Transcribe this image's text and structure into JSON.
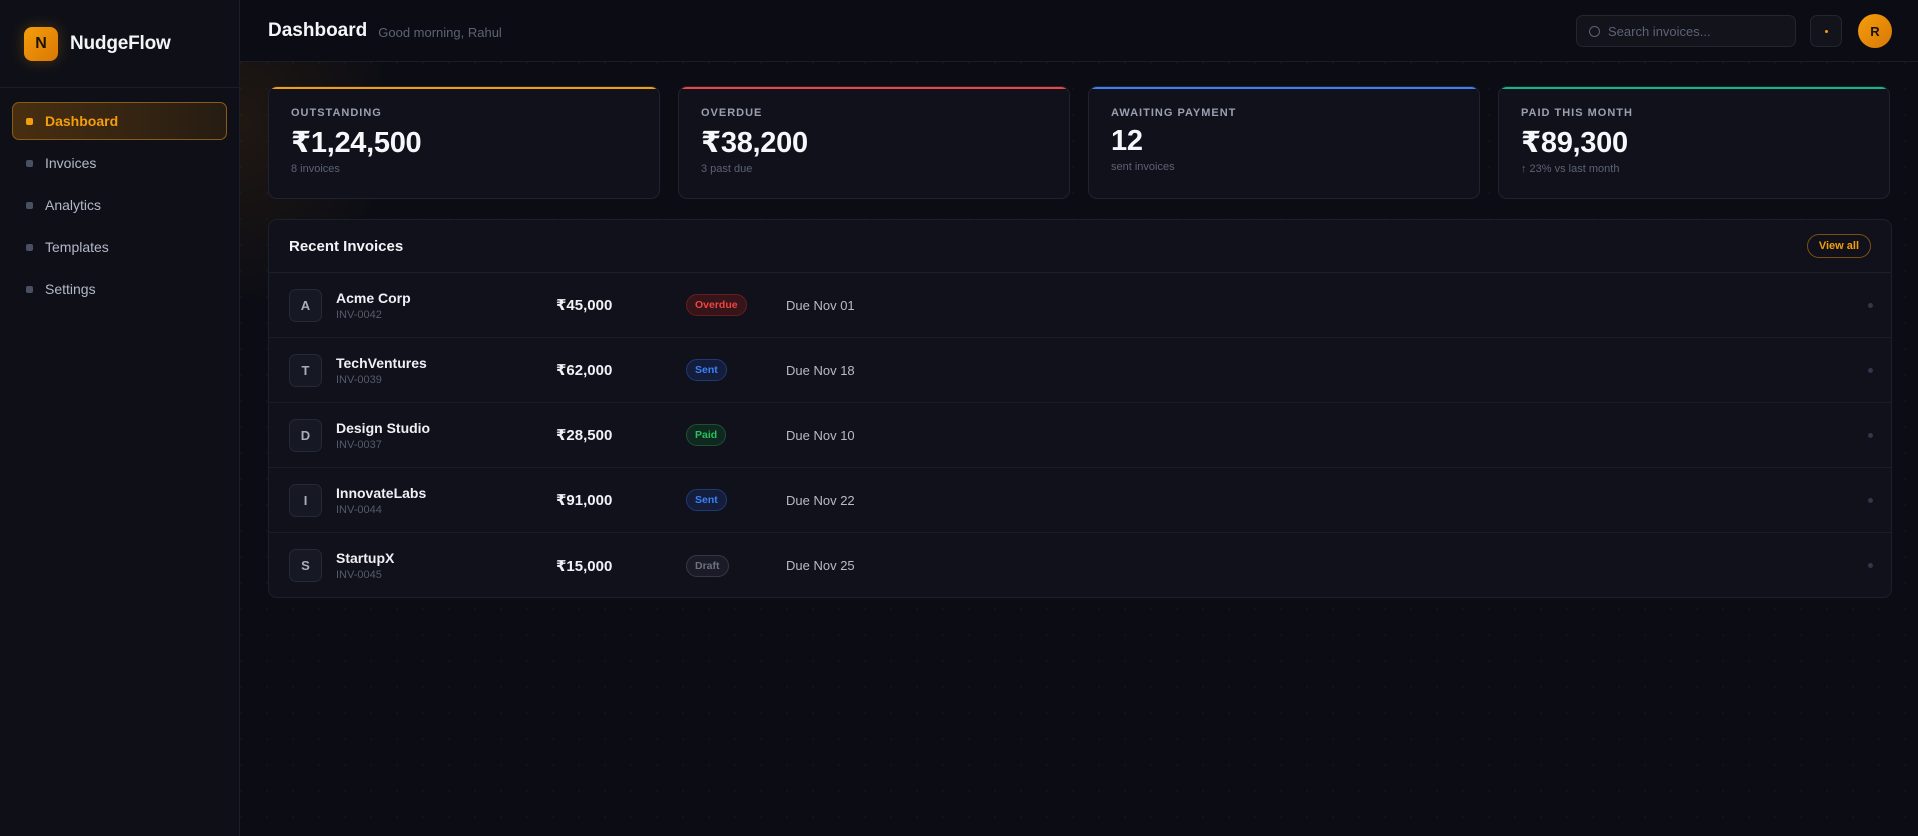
{
  "brand": {
    "logo_letter": "N",
    "name": "NudgeFlow",
    "accent": "#f59e0b"
  },
  "sidebar": {
    "items": [
      {
        "label": "Dashboard",
        "active": true
      },
      {
        "label": "Invoices",
        "active": false
      },
      {
        "label": "Analytics",
        "active": false
      },
      {
        "label": "Templates",
        "active": false
      },
      {
        "label": "Settings",
        "active": false
      }
    ]
  },
  "header": {
    "title": "Dashboard",
    "greeting": "Good morning, Rahul",
    "search_placeholder": "Search invoices...",
    "notification_icon": "notification-dot-icon",
    "avatar_letter": "R"
  },
  "stats": [
    {
      "label": "OUTSTANDING",
      "value": "₹1,24,500",
      "sub": "8 invoices",
      "accent": "#f59e0b"
    },
    {
      "label": "OVERDUE",
      "value": "₹38,200",
      "sub": "3 past due",
      "accent": "#ef4444"
    },
    {
      "label": "AWAITING PAYMENT",
      "value": "12",
      "sub": "sent invoices",
      "accent": "#3b82f6"
    },
    {
      "label": "PAID THIS MONTH",
      "value": "₹89,300",
      "sub": "↑ 23% vs last month",
      "accent": "#10b981"
    }
  ],
  "recent_invoices": {
    "title": "Recent Invoices",
    "view_all_label": "View all",
    "rows": [
      {
        "initial": "A",
        "client": "Acme Corp",
        "invoice_id": "INV-0042",
        "amount": "₹45,000",
        "status": "Overdue",
        "due": "Due Nov 01"
      },
      {
        "initial": "T",
        "client": "TechVentures",
        "invoice_id": "INV-0039",
        "amount": "₹62,000",
        "status": "Sent",
        "due": "Due Nov 18"
      },
      {
        "initial": "D",
        "client": "Design Studio",
        "invoice_id": "INV-0037",
        "amount": "₹28,500",
        "status": "Paid",
        "due": "Due Nov 10"
      },
      {
        "initial": "I",
        "client": "InnovateLabs",
        "invoice_id": "INV-0044",
        "amount": "₹91,000",
        "status": "Sent",
        "due": "Due Nov 22"
      },
      {
        "initial": "S",
        "client": "StartupX",
        "invoice_id": "INV-0045",
        "amount": "₹15,000",
        "status": "Draft",
        "due": "Due Nov 25"
      }
    ]
  },
  "status_colors": {
    "Overdue": "#ef4444",
    "Sent": "#3b82f6",
    "Paid": "#22c55e",
    "Draft": "#6b7280"
  }
}
